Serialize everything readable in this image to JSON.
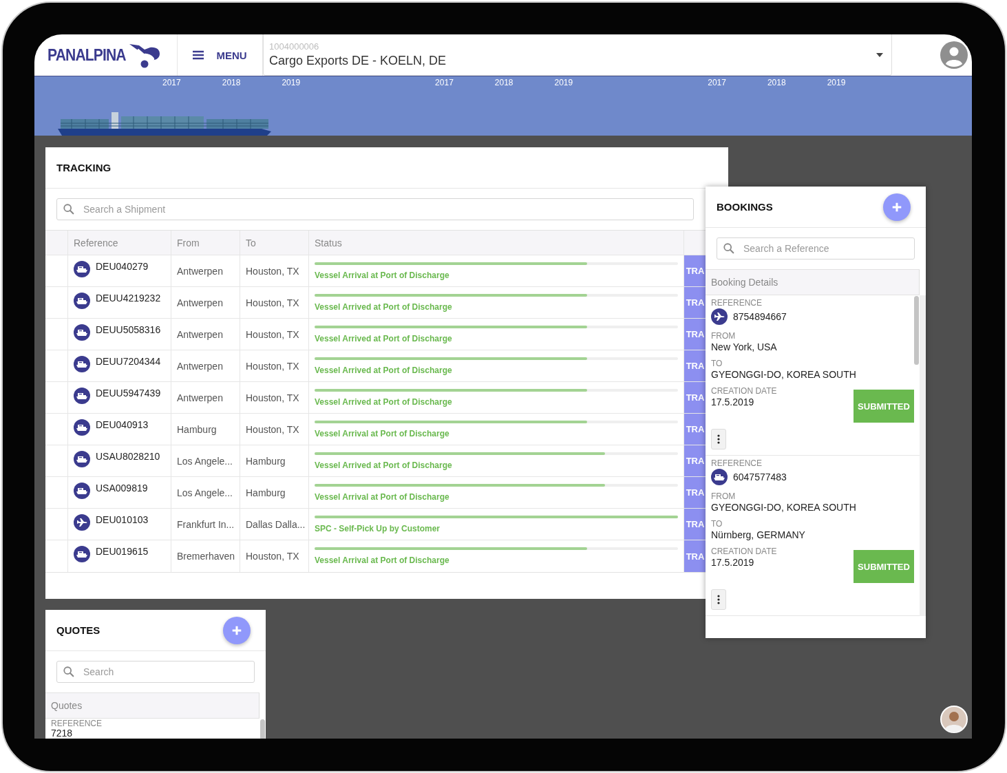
{
  "header": {
    "logo": "PANALPINA",
    "menu_label": "MENU",
    "account_select": {
      "label": "1004000006",
      "value": "Cargo Exports DE - KOELN, DE"
    }
  },
  "banner": {
    "year_groups": [
      [
        "2017",
        "2018",
        "2019"
      ],
      [
        "2017",
        "2018",
        "2019"
      ],
      [
        "2017",
        "2018",
        "2019"
      ]
    ]
  },
  "tracking": {
    "title": "TRACKING",
    "search": {
      "placeholder": "Search a Shipment"
    },
    "columns": [
      "Reference",
      "From",
      "To",
      "Status"
    ],
    "rows": [
      {
        "kind": "ship",
        "reference": "DEU040279",
        "from": "Antwerpen",
        "to": "Houston, TX",
        "status": "Vessel Arrival at Port of Discharge",
        "level": 0.75,
        "action": "TRA"
      },
      {
        "kind": "ship",
        "reference": "DEUU4219232",
        "from": "Antwerpen",
        "to": "Houston, TX",
        "status": "Vessel Arrived at Port of Discharge",
        "level": 0.75,
        "action": "TRA"
      },
      {
        "kind": "ship",
        "reference": "DEUU5058316",
        "from": "Antwerpen",
        "to": "Houston, TX",
        "status": "Vessel Arrived at Port of Discharge",
        "level": 0.75,
        "action": "TRA"
      },
      {
        "kind": "ship",
        "reference": "DEUU7204344",
        "from": "Antwerpen",
        "to": "Houston, TX",
        "status": "Vessel Arrived at Port of Discharge",
        "level": 0.75,
        "action": "TRA"
      },
      {
        "kind": "ship",
        "reference": "DEUU5947439",
        "from": "Antwerpen",
        "to": "Houston, TX",
        "status": "Vessel Arrived at Port of Discharge",
        "level": 0.75,
        "action": "TRA"
      },
      {
        "kind": "ship",
        "reference": "DEU040913",
        "from": "Hamburg",
        "to": "Houston, TX",
        "status": "Vessel Arrival at Port of Discharge",
        "level": 0.75,
        "action": "TRA"
      },
      {
        "kind": "ship",
        "reference": "USAU8028210",
        "from": "Los Angele...",
        "to": "Hamburg",
        "status": "Vessel Arrived at Port of Discharge",
        "level": 0.8,
        "action": "TRA"
      },
      {
        "kind": "ship",
        "reference": "USA009819",
        "from": "Los Angele...",
        "to": "Hamburg",
        "status": "Vessel Arrival at Port of Discharge",
        "level": 0.8,
        "action": "TRA"
      },
      {
        "kind": "plane",
        "reference": "DEU010103",
        "from": "Frankfurt In...",
        "to": "Dallas Dalla...",
        "status": "SPC - Self-Pick Up by Customer",
        "level": 1.0,
        "action": "TRA"
      },
      {
        "kind": "ship",
        "reference": "DEU019615",
        "from": "Bremerhaven",
        "to": "Houston, TX",
        "status": "Vessel Arrival at Port of Discharge",
        "level": 0.75,
        "action": "TRA"
      }
    ]
  },
  "bookings": {
    "title": "BOOKINGS",
    "search": {
      "placeholder": "Search a Reference"
    },
    "list_header": "Booking Details",
    "items": [
      {
        "kind": "plane",
        "reference_label": "REFERENCE",
        "reference": "8754894667",
        "from_label": "FROM",
        "from": "New York, USA",
        "to_label": "TO",
        "to": "GYEONGGI-DO, KOREA SOUTH",
        "date_label": "CREATION DATE",
        "date": "17.5.2019",
        "status": "SUBMITTED"
      },
      {
        "kind": "ship",
        "reference_label": "REFERENCE",
        "reference": "6047577483",
        "from_label": "FROM",
        "from": "GYEONGGI-DO, KOREA SOUTH",
        "to_label": "TO",
        "to": "Nürnberg, GERMANY",
        "date_label": "CREATION DATE",
        "date": "17.5.2019",
        "status": "SUBMITTED"
      }
    ]
  },
  "quotes": {
    "title": "QUOTES",
    "search": {
      "placeholder": "Search"
    },
    "list_header": "Quotes",
    "items": [
      {
        "reference_label": "REFERENCE",
        "reference": "7218"
      }
    ]
  }
}
